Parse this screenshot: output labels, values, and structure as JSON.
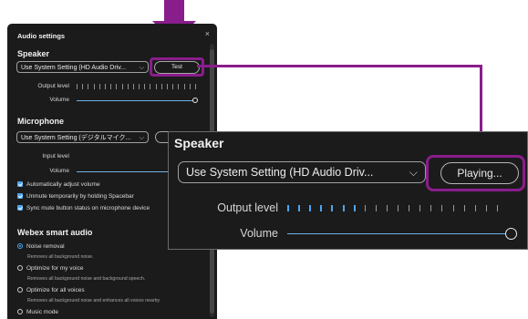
{
  "dialog": {
    "title": "Audio settings",
    "close_glyph": "×",
    "speaker": {
      "heading": "Speaker",
      "device": "Use System Setting (HD Audio Driv...",
      "test_label": "Test",
      "output_label": "Output level",
      "volume_label": "Volume",
      "volume_level": 1.0
    },
    "microphone": {
      "heading": "Microphone",
      "device": "Use System Setting (デジタルマイク...",
      "input_label": "Input level",
      "volume_label": "Volume",
      "options": [
        "Automatically adjust volume",
        "Unmute temporarily by holding Spacebar",
        "Sync mute button status on microphone device"
      ]
    },
    "smart_audio": {
      "heading": "Webex smart audio",
      "options": [
        {
          "label": "Noise removal",
          "desc": "Removes all background noise.",
          "selected": true
        },
        {
          "label": "Optimize for my voice",
          "desc": "Removes all background noise and background speech.",
          "selected": false
        },
        {
          "label": "Optimize for all voices",
          "desc": "Removes all background noise and enhances all voices nearby",
          "selected": false
        },
        {
          "label": "Music mode",
          "desc": "",
          "selected": false
        }
      ]
    }
  },
  "inset": {
    "heading": "Speaker",
    "device": "Use System Setting (HD Audio Driv...",
    "playing_label": "Playing...",
    "output_label": "Output level",
    "volume_label": "Volume",
    "output_level": 0.35,
    "volume_level": 1.0
  },
  "colors": {
    "highlight": "#8a1d8c",
    "accent": "#4ea6f0",
    "panel": "#1b1b1b"
  }
}
